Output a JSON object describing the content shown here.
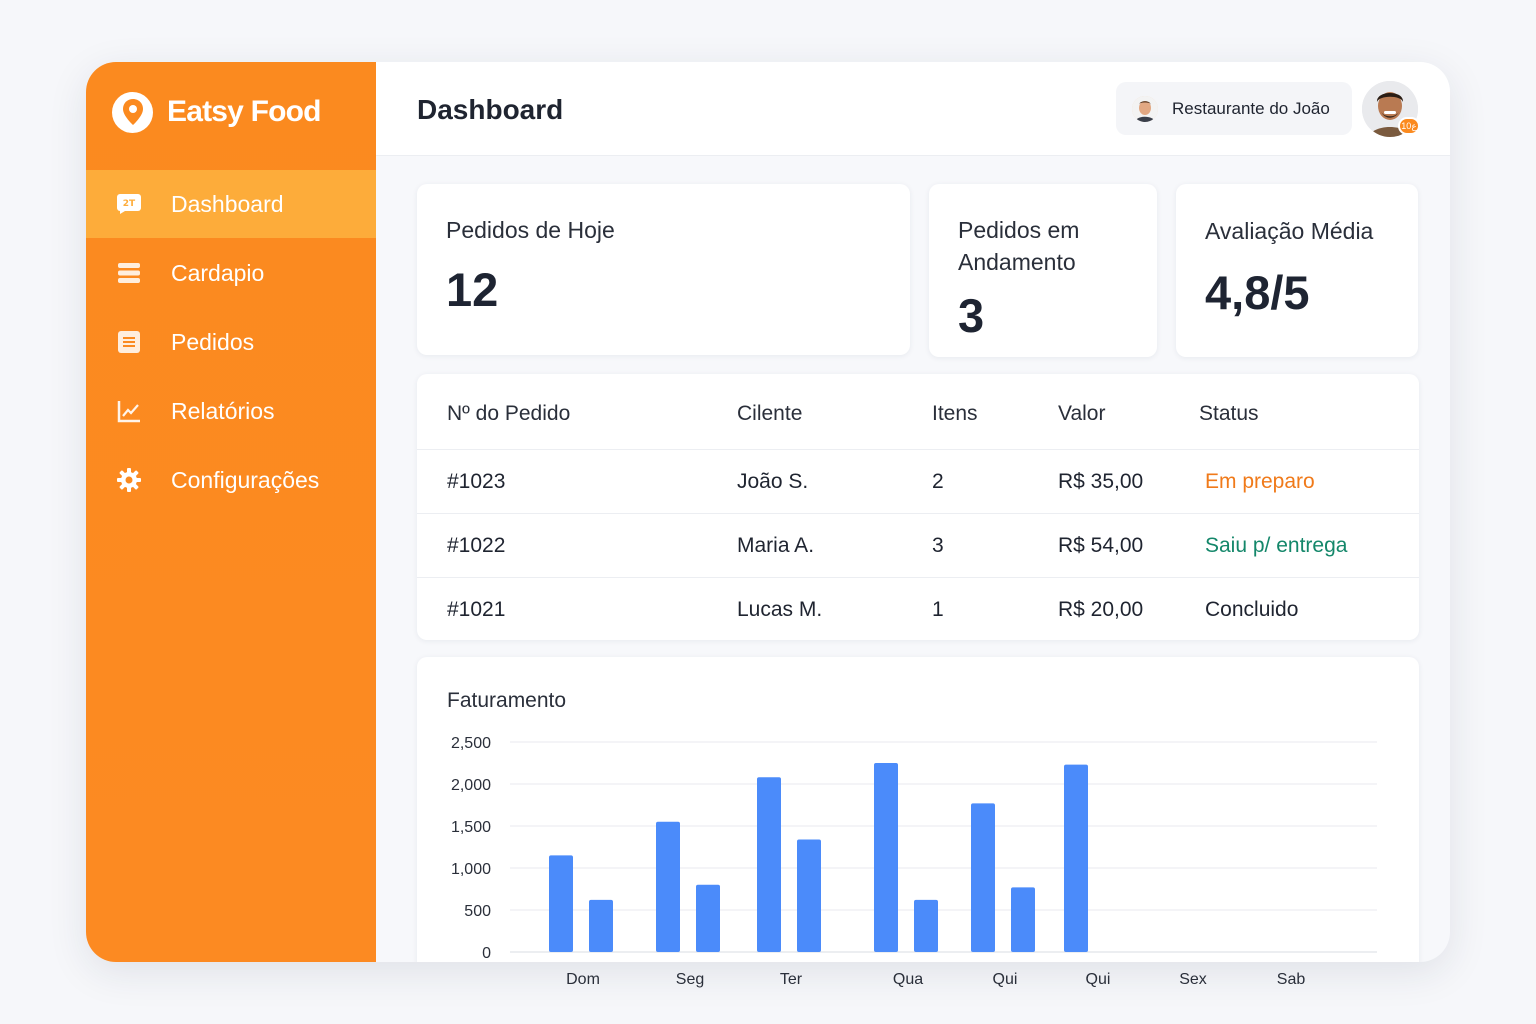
{
  "app": {
    "brand": "Eatsy Food",
    "colors": {
      "primary": "#fb8a1f",
      "active": "#fdac3a",
      "chart_bar": "#4b8bfa",
      "status_preparing": "#f07a1a",
      "status_delivery": "#14876a"
    }
  },
  "sidebar": {
    "items": [
      {
        "label": "Dashboard",
        "icon": "dashboard-icon",
        "active": true
      },
      {
        "label": "Cardapio",
        "icon": "menu-list-icon",
        "active": false
      },
      {
        "label": "Pedidos",
        "icon": "orders-icon",
        "active": false
      },
      {
        "label": "Relatórios",
        "icon": "chart-icon",
        "active": false
      },
      {
        "label": "Configurações",
        "icon": "gear-icon",
        "active": false
      }
    ]
  },
  "header": {
    "title": "Dashboard",
    "restaurant": "Restaurante do João",
    "profile_badge": "ع10"
  },
  "stats": [
    {
      "label": "Pedidos de Hoje",
      "value": "12"
    },
    {
      "label": "Pedidos em Andamento",
      "value": "3"
    },
    {
      "label": "Avaliação Média",
      "value": "4,8/5"
    }
  ],
  "orders": {
    "columns": [
      "Nº do Pedido",
      "Cilente",
      "Itens",
      "Valor",
      "Status"
    ],
    "rows": [
      {
        "id": "#1023",
        "client": "João S.",
        "items": "2",
        "value": "R$ 35,00",
        "status": "Em preparo",
        "status_color": "#f07a1a"
      },
      {
        "id": "#1022",
        "client": "Maria A.",
        "items": "3",
        "value": "R$ 54,00",
        "status": "Saiu p/ entrega",
        "status_color": "#14876a"
      },
      {
        "id": "#1021",
        "client": "Lucas M.",
        "items": "1",
        "value": "R$ 20,00",
        "status": "Concluido",
        "status_color": "#1f2430"
      }
    ]
  },
  "chart_data": {
    "type": "bar",
    "title": "Faturamento",
    "categories": [
      "Dom",
      "Seg",
      "Ter",
      "Qua",
      "Qui",
      "Qui",
      "Sex",
      "Sab"
    ],
    "series": [
      {
        "values": [
          1150,
          1550,
          2080,
          2250,
          1770,
          2230,
          0,
          0
        ]
      },
      {
        "values": [
          620,
          800,
          1340,
          620,
          770,
          null,
          null,
          null
        ]
      }
    ],
    "ylim": [
      0,
      2500
    ],
    "yticks": [
      "0",
      "500",
      "1,000",
      "1,500",
      "2,000",
      "2,500"
    ],
    "grid": true
  }
}
